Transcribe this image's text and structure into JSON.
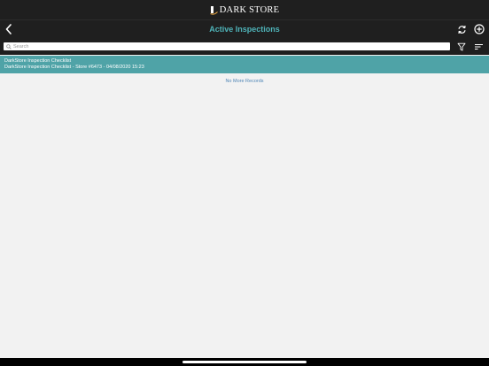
{
  "brand": {
    "name": "DARK STORE",
    "logo_icon": "dark-store-logo-icon"
  },
  "nav": {
    "title": "Active Inspections",
    "back_icon": "chevron-left-icon",
    "refresh_icon": "refresh-icon",
    "add_icon": "plus-circle-icon"
  },
  "search": {
    "placeholder": "Search",
    "value": "",
    "filter_icon": "filter-icon",
    "sort_icon": "sort-icon"
  },
  "list": {
    "items": [
      {
        "title": "DarkStore Inspection Checklist",
        "subtitle": "DarkStore Inspection Checklist - Store #6473 - 04/08/2020 15:23"
      }
    ],
    "footer": "No More Records"
  },
  "colors": {
    "bar_background": "#1f1f1f",
    "accent": "#4fb4b9",
    "row_highlight": "#4fa3a7",
    "link_text": "#4f86b6",
    "content_background": "#f2f2f2"
  }
}
